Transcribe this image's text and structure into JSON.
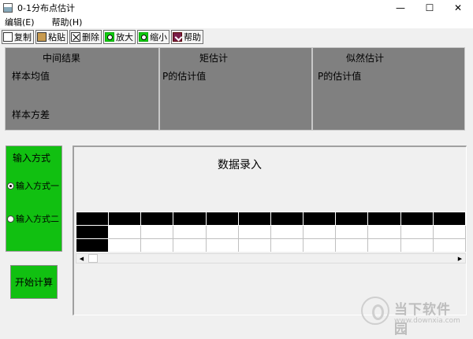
{
  "window": {
    "title": "0-1分布点估计"
  },
  "window_controls": {
    "minimize": "—",
    "maximize": "☐",
    "close": "✕"
  },
  "menu": {
    "items": [
      "编辑(E)",
      "帮助(H)"
    ]
  },
  "toolbar": {
    "buttons": [
      {
        "label": "复制",
        "icon": "copy-icon"
      },
      {
        "label": "粘贴",
        "icon": "paste-icon"
      },
      {
        "label": "删除",
        "icon": "delete-icon"
      },
      {
        "label": "放大",
        "icon": "zoom-in-icon"
      },
      {
        "label": "缩小",
        "icon": "zoom-out-icon"
      },
      {
        "label": "帮助",
        "icon": "help-icon"
      }
    ]
  },
  "results": {
    "intermediate": {
      "title": "中间结果",
      "mean_label": "样本均值",
      "variance_label": "样本方差"
    },
    "moment": {
      "title": "矩估计",
      "p_label": "P的估计值"
    },
    "likelihood": {
      "title": "似然估计",
      "p_label": "P的估计值"
    }
  },
  "input_mode": {
    "title": "输入方式",
    "options": [
      {
        "label": "输入方式一",
        "checked": true
      },
      {
        "label": "输入方式二",
        "checked": false
      }
    ]
  },
  "start_button": {
    "label": "开始计算"
  },
  "data_entry": {
    "title": "数据录入"
  },
  "watermark": {
    "name": "当下软件园",
    "url": "www.downxia.com"
  },
  "colors": {
    "panel_gray": "#808080",
    "input_green": "#11c011",
    "grid_header": "#000000"
  }
}
